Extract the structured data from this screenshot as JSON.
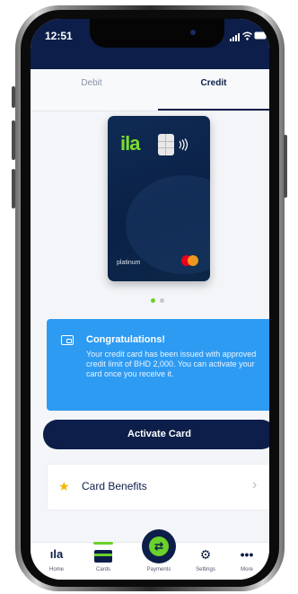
{
  "status_bar": {
    "time": "12:51"
  },
  "tabs": [
    {
      "label": "Debit",
      "active": false
    },
    {
      "label": "Credit",
      "active": true
    }
  ],
  "card": {
    "brand_logo": "ila",
    "type_label": "platinum",
    "network": "mastercard"
  },
  "carousel": {
    "active_index": 0,
    "count": 2
  },
  "banner": {
    "title": "Congratulations!",
    "message": "Your credit card has been issued with approved credit limit of BHD 2,000. You can activate your card once you receive it."
  },
  "activate_button": {
    "label": "Activate Card"
  },
  "benefits_row": {
    "label": "Card Benefits"
  },
  "bottom_nav": [
    {
      "label": "Home",
      "icon": "home-logo-icon",
      "active": false
    },
    {
      "label": "Cards",
      "icon": "card-icon",
      "active": true
    },
    {
      "label": "Payments",
      "icon": "transfer-icon",
      "active": false
    },
    {
      "label": "Settings",
      "icon": "gear-icon",
      "active": false
    },
    {
      "label": "More",
      "icon": "more-icon",
      "active": false
    }
  ],
  "colors": {
    "navy": "#0c1e49",
    "accent_green": "#6bd12c",
    "banner_blue": "#2e9bf2",
    "star_yellow": "#f5b400"
  }
}
